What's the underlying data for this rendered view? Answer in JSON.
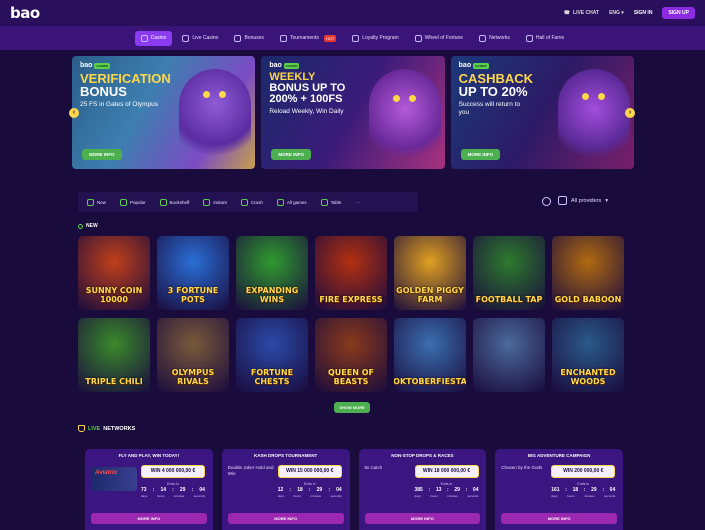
{
  "header": {
    "logo": "bao",
    "live_chat": "LIVE CHAT",
    "language": "ENG",
    "sign_in": "SIGN IN",
    "sign_up": "SIGN UP"
  },
  "nav": {
    "items": [
      {
        "label": "Casino",
        "active": true
      },
      {
        "label": "Live Casino"
      },
      {
        "label": "Bonuses"
      },
      {
        "label": "Tournaments",
        "badge": "HOT"
      },
      {
        "label": "Loyalty Program"
      },
      {
        "label": "Wheel of Fortune"
      },
      {
        "label": "Networks"
      },
      {
        "label": "Hall of Fame"
      }
    ]
  },
  "banners": [
    {
      "logo": "bao",
      "tag": "CASINO",
      "title_line1": "VERIFICATION",
      "title_line2": "BONUS",
      "subtitle": "25 FS in Gates of Olympus",
      "button": "MORE INFO"
    },
    {
      "logo": "bao",
      "tag": "CASINO",
      "title_line1": "WEEKLY",
      "title_line2": "BONUS UP TO",
      "title_line3": "200% + 100FS",
      "subtitle": "Reload Weekly, Win Daily",
      "button": "MORE INFO"
    },
    {
      "logo": "bao",
      "tag": "CASINO",
      "title_line1": "CASHBACK",
      "title_line2": "UP TO 20%",
      "subtitle": "Success will return to you",
      "button": "MORE INFO"
    }
  ],
  "filters": [
    "New",
    "Popular",
    "Bookshelf",
    "Instant",
    "Crash",
    "All games",
    "Table",
    "···"
  ],
  "providers_label": "All providers",
  "section_new": "NEW",
  "games": [
    {
      "title": "Sunny Coin 10000",
      "color": "#c0401a"
    },
    {
      "title": "3 Fortune Pots",
      "color": "#2a6fd6"
    },
    {
      "title": "Expanding Wins",
      "color": "#2f9a2f"
    },
    {
      "title": "Fire Express",
      "color": "#b33010"
    },
    {
      "title": "Golden Piggy Farm",
      "color": "#e0a020"
    },
    {
      "title": "Football Tap",
      "color": "#2d7a2d"
    },
    {
      "title": "Gold Baboon",
      "color": "#b06a10"
    },
    {
      "title": "Triple Chili",
      "color": "#3a8a2a"
    },
    {
      "title": "Olympus Rivals",
      "color": "#7a5a3a"
    },
    {
      "title": "Fortune Chests",
      "color": "#2a4aa8"
    },
    {
      "title": "Queen of Beasts",
      "color": "#8a3a1a"
    },
    {
      "title": "Oktoberfiesta",
      "color": "#3a6fb0"
    },
    {
      "title": "",
      "color": "#4a6a9a"
    },
    {
      "title": "Enchanted Woods",
      "color": "#2a5a8a"
    }
  ],
  "show_more": "SHOW MORE",
  "live_networks": {
    "live": "LIVE",
    "networks": "NETWORKS"
  },
  "promos": [
    {
      "title": "FLY AND PLAY, WIN TODAY!",
      "left": "Aviatrix",
      "prize": "WIN 4 000 000,00 €",
      "ends": "Ends in",
      "timer": [
        "73",
        "14",
        "29",
        "04"
      ],
      "units": [
        "days",
        "hours",
        "minutes",
        "seconds"
      ],
      "button": "MORE INFO"
    },
    {
      "title": "KASH DROPS TOURNAMENT",
      "left": "Double Joker Hold and Win",
      "prize": "WIN 15 000 000,00 €",
      "ends": "Ends in",
      "timer": [
        "12",
        "18",
        "29",
        "04"
      ],
      "units": [
        "days",
        "hours",
        "minutes",
        "seconds"
      ],
      "button": "MORE INFO"
    },
    {
      "title": "NON-STOP DROPS & RACES",
      "left": "8x Catch",
      "prize": "WIN 18 000 000,00 €",
      "ends": "Ends in",
      "timer": [
        "385",
        "13",
        "29",
        "04"
      ],
      "units": [
        "days",
        "hours",
        "minutes",
        "seconds"
      ],
      "button": "MORE INFO"
    },
    {
      "title": "BIG ADVENTURE CAMPAIGN",
      "left": "Chosen by the Gods",
      "prize": "WIN 200 000,00 €",
      "ends": "Ends in",
      "timer": [
        "161",
        "18",
        "29",
        "04"
      ],
      "units": [
        "days",
        "hours",
        "minutes",
        "seconds"
      ],
      "button": "MORE INFO"
    }
  ]
}
